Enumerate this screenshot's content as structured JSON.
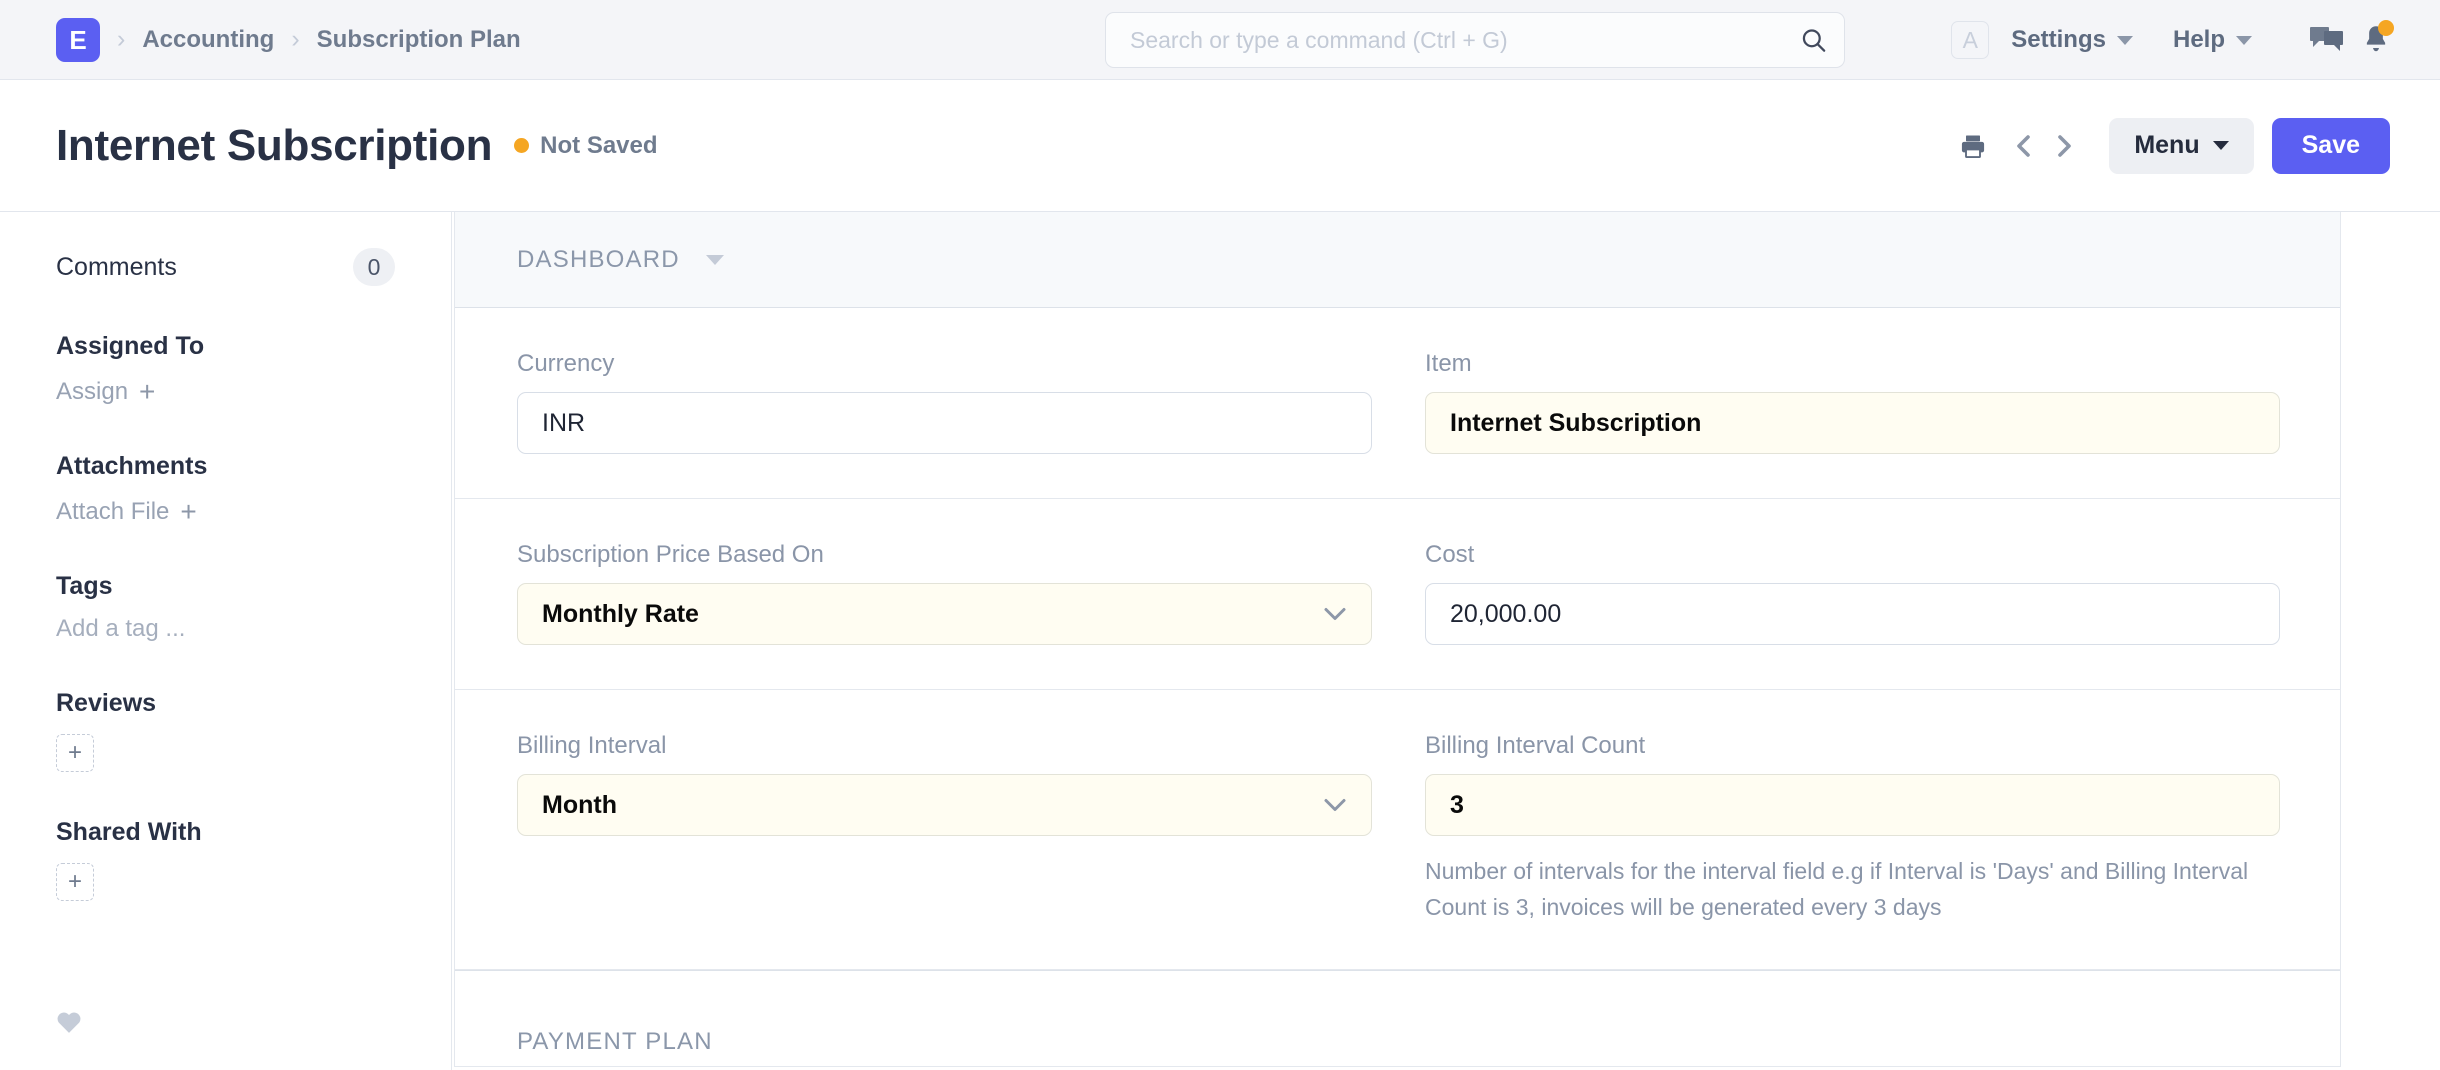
{
  "navbar": {
    "logo_letter": "E",
    "breadcrumbs": [
      "Accounting",
      "Subscription Plan"
    ],
    "search": {
      "placeholder": "Search or type a command (Ctrl + G)",
      "value": "",
      "icon": "search-icon"
    },
    "avatar_letter": "A",
    "menus": [
      {
        "label": "Settings",
        "icon": "chevron-down-icon"
      },
      {
        "label": "Help",
        "icon": "chevron-down-icon"
      }
    ],
    "icons": [
      {
        "name": "chat-icon"
      },
      {
        "name": "notification-bell-icon",
        "badge": true
      }
    ]
  },
  "page_head": {
    "title": "Internet Subscription",
    "status": "Not Saved",
    "status_color": "#f5a623",
    "actions": {
      "print_icon": "printer-icon",
      "prev_icon": "chevron-left-icon",
      "next_icon": "chevron-right-icon",
      "menu_label": "Menu",
      "save_label": "Save",
      "save_color": "#5b5ff2"
    }
  },
  "sidebar": {
    "comments": {
      "label": "Comments",
      "count": "0"
    },
    "assigned_to": {
      "heading": "Assigned To",
      "action": "Assign"
    },
    "attachments": {
      "heading": "Attachments",
      "action": "Attach File"
    },
    "tags": {
      "heading": "Tags",
      "placeholder": "Add a tag ..."
    },
    "reviews": {
      "heading": "Reviews",
      "add": "+"
    },
    "shared_with": {
      "heading": "Shared With",
      "add": "+"
    },
    "like_icon": "heart-icon"
  },
  "main": {
    "sections": [
      {
        "label": "DASHBOARD",
        "collapse_icon": "chevron-down-icon"
      },
      {
        "label": "PAYMENT PLAN"
      }
    ],
    "fields": {
      "currency": {
        "label": "Currency",
        "value": "INR",
        "modified": false,
        "type": "text"
      },
      "item": {
        "label": "Item",
        "value": "Internet Subscription",
        "modified": true,
        "type": "text"
      },
      "price_based_on": {
        "label": "Subscription Price Based On",
        "value": "Monthly Rate",
        "modified": true,
        "type": "select"
      },
      "cost": {
        "label": "Cost",
        "value": "20,000.00",
        "modified": false,
        "type": "text"
      },
      "billing_interval": {
        "label": "Billing Interval",
        "value": "Month",
        "modified": true,
        "type": "select"
      },
      "billing_interval_count": {
        "label": "Billing Interval Count",
        "value": "3",
        "modified": true,
        "type": "text",
        "help": "Number of intervals for the interval field e.g if Interval is 'Days' and Billing Interval Count is 3, invoices will be generated every 3 days"
      }
    }
  }
}
